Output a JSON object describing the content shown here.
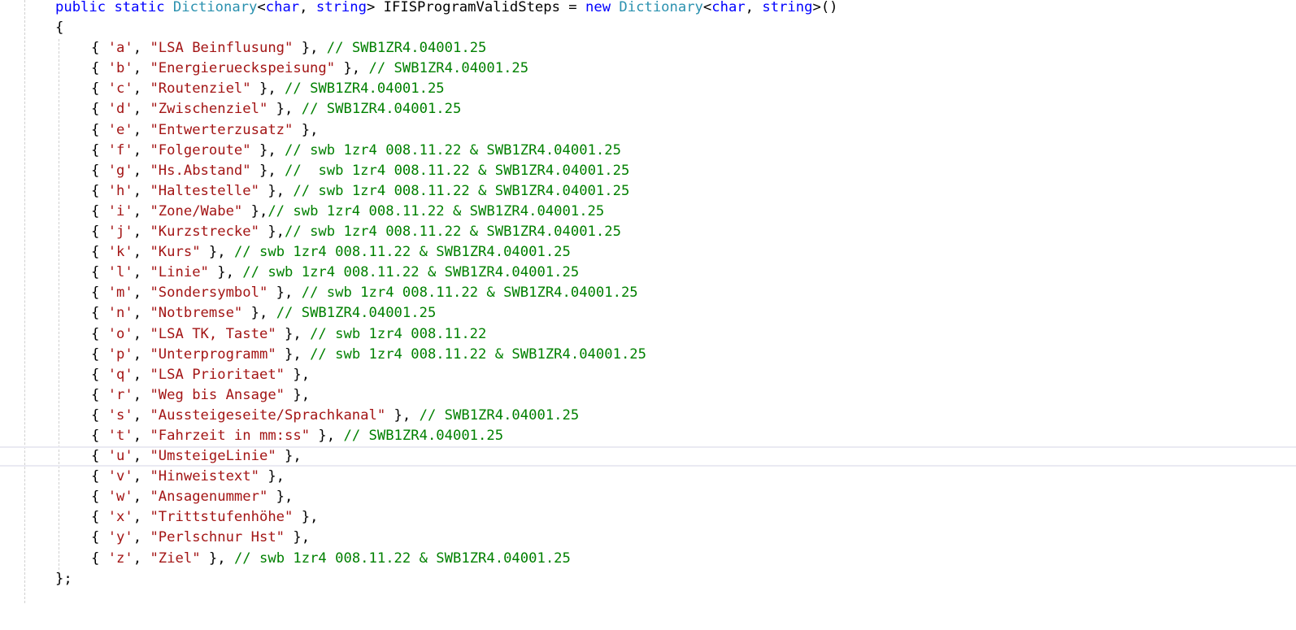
{
  "editor": {
    "declaration": {
      "kw_public": "public",
      "kw_static": "static",
      "type_dictionary": "Dictionary",
      "open_generic": "<",
      "kw_char": "char",
      "comma": ", ",
      "kw_string": "string",
      "close_generic": ">",
      "field_name": " IFISProgramValidSteps = ",
      "kw_new": "new",
      "type_dictionary_2": "Dictionary",
      "tail": ">()"
    },
    "open_brace": "{",
    "close_brace": "};",
    "entries": [
      {
        "key": "'a'",
        "value": "\"LSA Beinflusung\"",
        "sep": " }, ",
        "comment": "// SWB1ZR4.04001.25"
      },
      {
        "key": "'b'",
        "value": "\"Energierueckspeisung\"",
        "sep": " }, ",
        "comment": "// SWB1ZR4.04001.25"
      },
      {
        "key": "'c'",
        "value": "\"Routenziel\"",
        "sep": " }, ",
        "comment": "// SWB1ZR4.04001.25"
      },
      {
        "key": "'d'",
        "value": "\"Zwischenziel\"",
        "sep": " }, ",
        "comment": "// SWB1ZR4.04001.25"
      },
      {
        "key": "'e'",
        "value": "\"Entwerterzusatz\"",
        "sep": " },",
        "comment": ""
      },
      {
        "key": "'f'",
        "value": "\"Folgeroute\"",
        "sep": " }, ",
        "comment": "// swb 1zr4 008.11.22 & SWB1ZR4.04001.25"
      },
      {
        "key": "'g'",
        "value": "\"Hs.Abstand\"",
        "sep": " }, ",
        "comment": "//  swb 1zr4 008.11.22 & SWB1ZR4.04001.25"
      },
      {
        "key": "'h'",
        "value": "\"Haltestelle\"",
        "sep": " }, ",
        "comment": "// swb 1zr4 008.11.22 & SWB1ZR4.04001.25"
      },
      {
        "key": "'i'",
        "value": "\"Zone/Wabe\"",
        "sep": " },",
        "comment": "// swb 1zr4 008.11.22 & SWB1ZR4.04001.25"
      },
      {
        "key": "'j'",
        "value": "\"Kurzstrecke\"",
        "sep": " },",
        "comment": "// swb 1zr4 008.11.22 & SWB1ZR4.04001.25"
      },
      {
        "key": "'k'",
        "value": "\"Kurs\"",
        "sep": " }, ",
        "comment": "// swb 1zr4 008.11.22 & SWB1ZR4.04001.25"
      },
      {
        "key": "'l'",
        "value": "\"Linie\"",
        "sep": " }, ",
        "comment": "// swb 1zr4 008.11.22 & SWB1ZR4.04001.25"
      },
      {
        "key": "'m'",
        "value": "\"Sondersymbol\"",
        "sep": " }, ",
        "comment": "// swb 1zr4 008.11.22 & SWB1ZR4.04001.25"
      },
      {
        "key": "'n'",
        "value": "\"Notbremse\"",
        "sep": " }, ",
        "comment": "// SWB1ZR4.04001.25"
      },
      {
        "key": "'o'",
        "value": "\"LSA TK, Taste\"",
        "sep": " }, ",
        "comment": "// swb 1zr4 008.11.22"
      },
      {
        "key": "'p'",
        "value": "\"Unterprogramm\"",
        "sep": " }, ",
        "comment": "// swb 1zr4 008.11.22 & SWB1ZR4.04001.25"
      },
      {
        "key": "'q'",
        "value": "\"LSA Prioritaet\"",
        "sep": " },",
        "comment": ""
      },
      {
        "key": "'r'",
        "value": "\"Weg bis Ansage\"",
        "sep": " },",
        "comment": ""
      },
      {
        "key": "'s'",
        "value": "\"Aussteigeseite/Sprachkanal\"",
        "sep": " }, ",
        "comment": "// SWB1ZR4.04001.25"
      },
      {
        "key": "'t'",
        "value": "\"Fahrzeit in mm:ss\"",
        "sep": " }, ",
        "comment": "// SWB1ZR4.04001.25"
      },
      {
        "key": "'u'",
        "value": "\"UmsteigeLinie\"",
        "sep": " },",
        "comment": ""
      },
      {
        "key": "'v'",
        "value": "\"Hinweistext\"",
        "sep": " },",
        "comment": ""
      },
      {
        "key": "'w'",
        "value": "\"Ansagenummer\"",
        "sep": " },",
        "comment": ""
      },
      {
        "key": "'x'",
        "value": "\"Trittstufenhöhe\"",
        "sep": " },",
        "comment": ""
      },
      {
        "key": "'y'",
        "value": "\"Perlschnur Hst\"",
        "sep": " },",
        "comment": ""
      },
      {
        "key": "'z'",
        "value": "\"Ziel\"",
        "sep": " }, ",
        "comment": "// swb 1zr4 008.11.22 & SWB1ZR4.04001.25"
      }
    ],
    "current_line_key": "'u'",
    "colors": {
      "keyword": "#0000ff",
      "type": "#2b91af",
      "string": "#a31515",
      "comment": "#008000",
      "current_line_border": "#eaeaf2",
      "guide": "#d0d0d0"
    }
  }
}
